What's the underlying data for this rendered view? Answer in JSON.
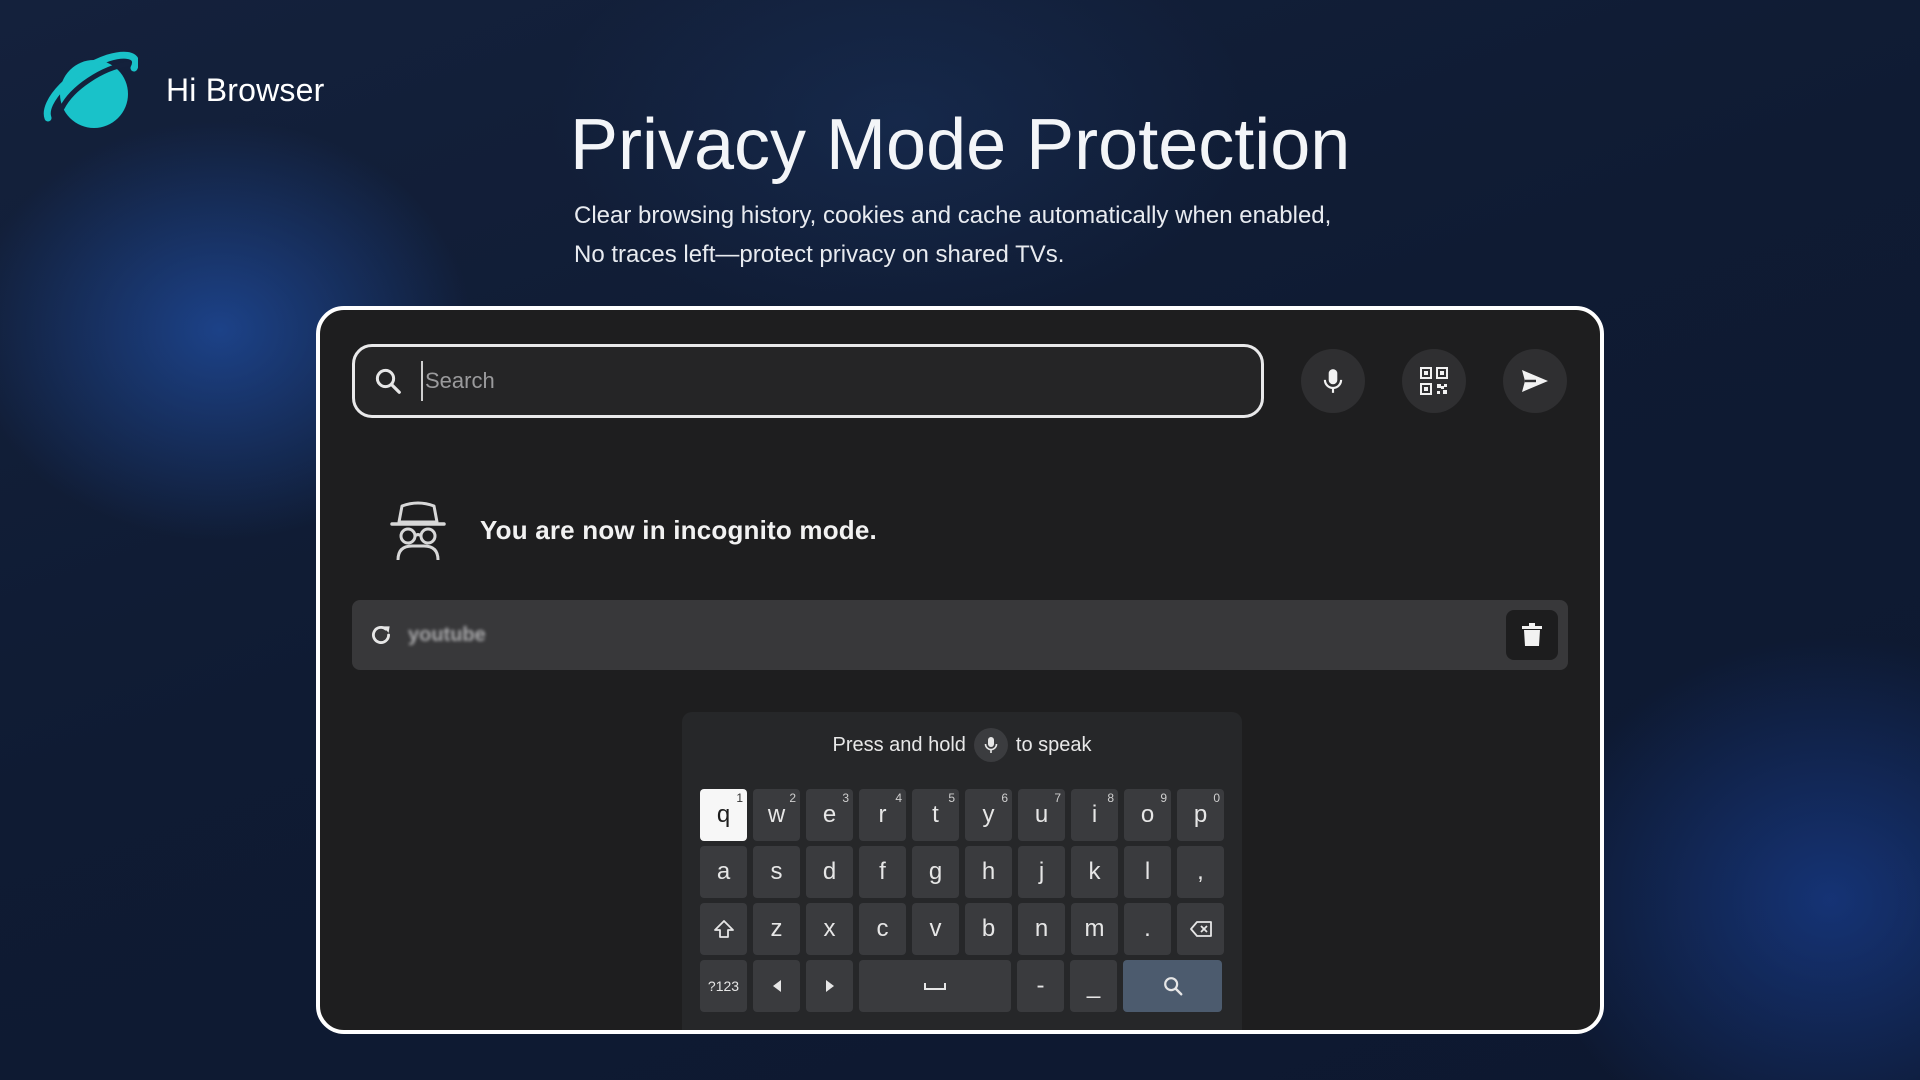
{
  "brand": {
    "name": "Hi Browser",
    "logo_icon": "planet-logo-icon",
    "accent": "#19c2c9"
  },
  "hero": {
    "title": "Privacy Mode Protection",
    "subtitle_line1": "Clear browsing history, cookies and cache automatically when enabled,",
    "subtitle_line2": "No traces left—protect privacy on shared TVs."
  },
  "search": {
    "placeholder": "Search",
    "value": "",
    "buttons": [
      "mic-icon",
      "qr-scan-icon",
      "send-icon"
    ]
  },
  "incognito": {
    "message": "You are now in incognito mode.",
    "icon": "incognito-spy-icon"
  },
  "history": {
    "items": [
      {
        "label": "youtube",
        "icon": "refresh-icon",
        "action_icon": "trash-icon"
      }
    ]
  },
  "keyboard": {
    "hint_before": "Press and hold",
    "hint_after": "to speak",
    "row1": [
      {
        "k": "q",
        "sup": "1"
      },
      {
        "k": "w",
        "sup": "2"
      },
      {
        "k": "e",
        "sup": "3"
      },
      {
        "k": "r",
        "sup": "4"
      },
      {
        "k": "t",
        "sup": "5"
      },
      {
        "k": "y",
        "sup": "6"
      },
      {
        "k": "u",
        "sup": "7"
      },
      {
        "k": "i",
        "sup": "8"
      },
      {
        "k": "o",
        "sup": "9"
      },
      {
        "k": "p",
        "sup": "0"
      }
    ],
    "row2": [
      "a",
      "s",
      "d",
      "f",
      "g",
      "h",
      "j",
      "k",
      "l",
      ","
    ],
    "row3": [
      "z",
      "x",
      "c",
      "v",
      "b",
      "n",
      "m",
      "."
    ],
    "row4": {
      "symbols": "?123",
      "dash": "-",
      "underscore": "_"
    },
    "active_key": "q"
  },
  "colors": {
    "panel_bg": "#1e1e1f",
    "key_bg": "#3a3b3e",
    "search_key": "#4c5b6e"
  }
}
